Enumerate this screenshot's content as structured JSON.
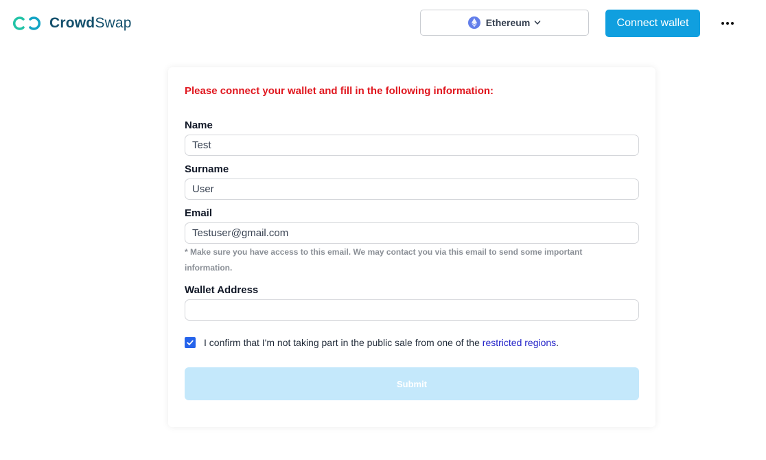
{
  "header": {
    "brand_part_a": "Crowd",
    "brand_part_b": "Swap",
    "network": {
      "label": "Ethereum",
      "icon": "ethereum-icon"
    },
    "connect_label": "Connect wallet",
    "more_icon": "ellipsis-icon"
  },
  "form": {
    "intro": "Please connect your wallet and fill in the following information:",
    "name": {
      "label": "Name",
      "value": "Test"
    },
    "surname": {
      "label": "Surname",
      "value": "User"
    },
    "email": {
      "label": "Email",
      "value": "Testuser@gmail.com",
      "hint": "* Make sure you have access to this email. We may contact you via this email to send some important information."
    },
    "wallet": {
      "label": "Wallet Address",
      "value": ""
    },
    "confirm": {
      "checked": true,
      "text": "I confirm that I'm not taking part in the public sale from one of the",
      "link": "restricted regions",
      "suffix": "."
    },
    "submit_label": "Submit"
  },
  "colors": {
    "accent": "#109fdf",
    "brand": "#14506c",
    "error_text": "#e0161e",
    "checkbox": "#2563eb",
    "submit_disabled": "#c4e8fb"
  }
}
